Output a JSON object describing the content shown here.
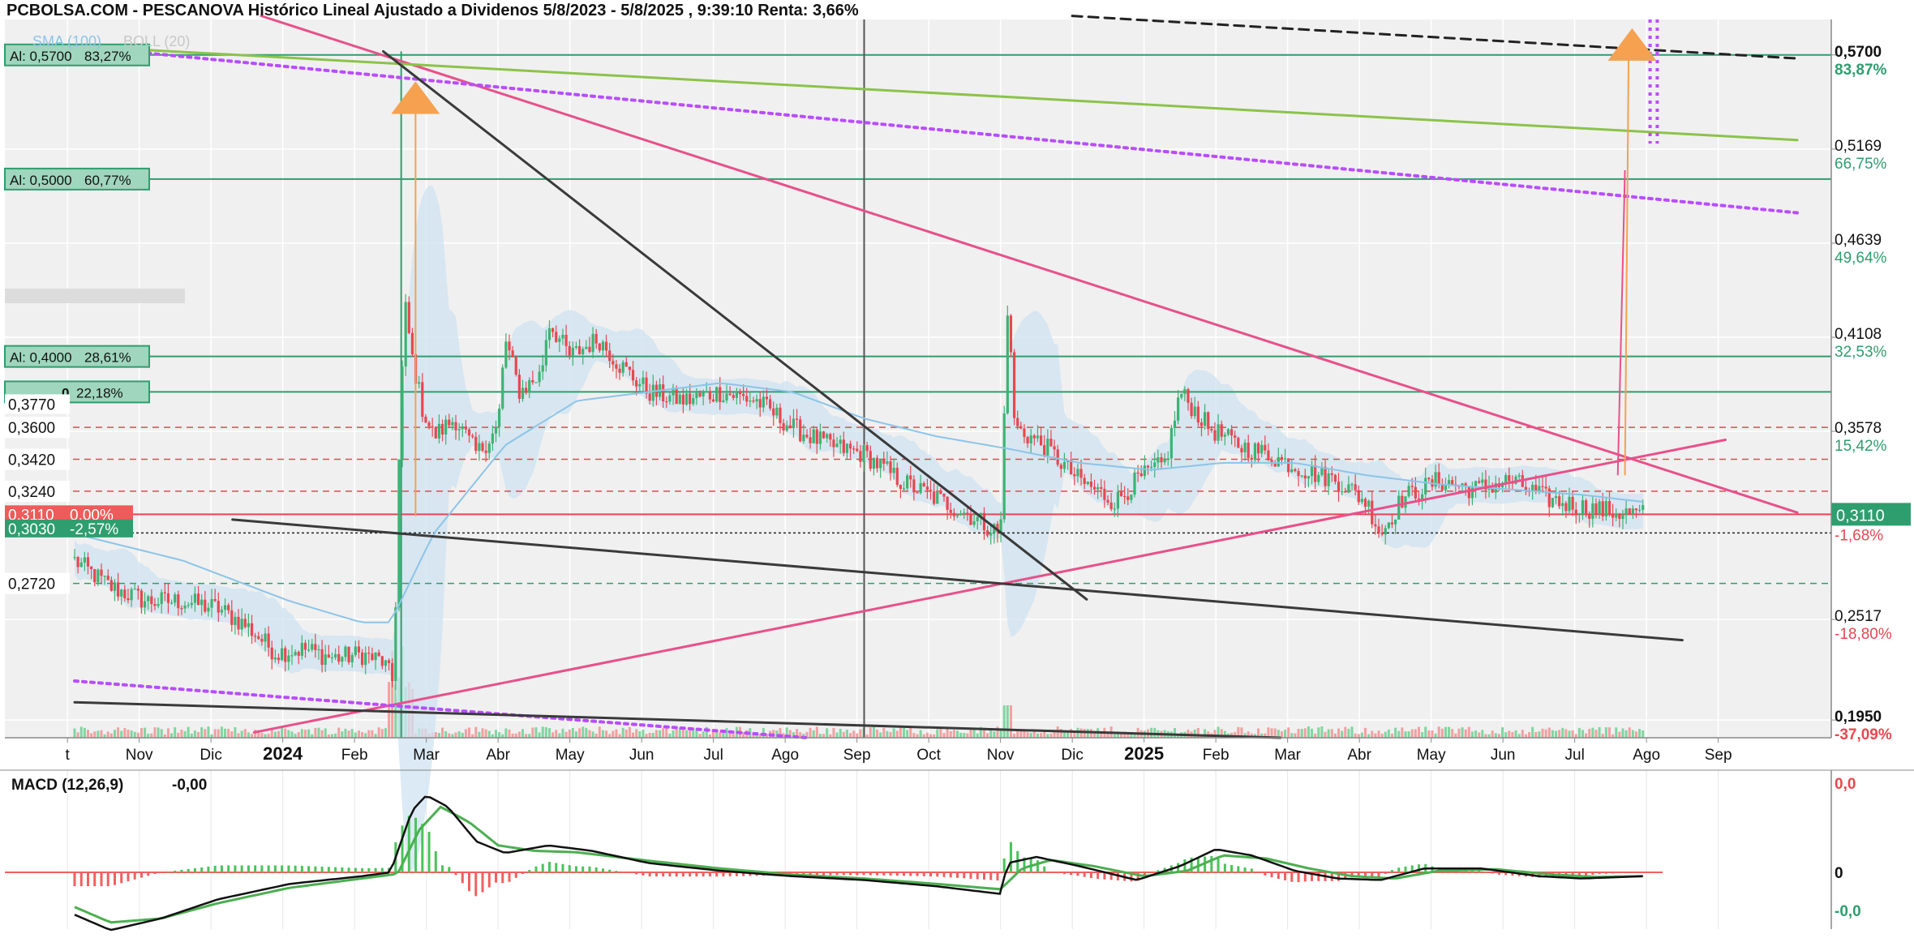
{
  "title": "PCBOLSA.COM - PESCANOVA Histórico Lineal Ajustado a Dividenos 5/8/2023 - 5/8/2025 , 9:39:10 Renta: 3,66%",
  "indicators_legend": {
    "sma": "SMA (100)",
    "boll": "BOLL (20)"
  },
  "colors": {
    "up": "#3cb371",
    "down": "#e8474f",
    "green_line": "#2e9e6e",
    "pink_line": "#e8508a",
    "purple_dotted": "#b84dff",
    "trend_dark": "#3a3a3a",
    "bollinger_fill": "#cfe3f2",
    "sma": "#8cc4e8",
    "tag_green": "#2e9e6e",
    "tag_red": "#f05a5a",
    "arrow": "#f5a150",
    "macd_up": "#49c45a",
    "macd_down": "#f06060"
  },
  "chart_data": [
    {
      "type": "line",
      "title": "PCBOLSA.COM - PESCANOVA Histórico Lineal Ajustado a Dividenos 5/8/2023 - 5/8/2025 , 9:39:10 Renta: 3,66%",
      "xlabel": "",
      "ylabel": "",
      "ylim": [
        0.185,
        0.59
      ],
      "grid": true,
      "x_ticks": [
        {
          "label": "t",
          "month": -0.1,
          "bold": false
        },
        {
          "label": "Nov",
          "month": 0.9,
          "bold": false
        },
        {
          "label": "Dic",
          "month": 1.9,
          "bold": false
        },
        {
          "label": "2024",
          "month": 2.9,
          "bold": true
        },
        {
          "label": "Feb",
          "month": 3.9,
          "bold": false
        },
        {
          "label": "Mar",
          "month": 4.9,
          "bold": false
        },
        {
          "label": "Abr",
          "month": 5.9,
          "bold": false
        },
        {
          "label": "May",
          "month": 6.9,
          "bold": false
        },
        {
          "label": "Jun",
          "month": 7.9,
          "bold": false
        },
        {
          "label": "Jul",
          "month": 8.9,
          "bold": false
        },
        {
          "label": "Ago",
          "month": 9.9,
          "bold": false
        },
        {
          "label": "Sep",
          "month": 10.9,
          "bold": false
        },
        {
          "label": "Oct",
          "month": 11.9,
          "bold": false
        },
        {
          "label": "Nov",
          "month": 12.9,
          "bold": false
        },
        {
          "label": "Dic",
          "month": 13.9,
          "bold": false
        },
        {
          "label": "2025",
          "month": 14.9,
          "bold": true
        },
        {
          "label": "Feb",
          "month": 15.9,
          "bold": false
        },
        {
          "label": "Mar",
          "month": 16.9,
          "bold": false
        },
        {
          "label": "Abr",
          "month": 17.9,
          "bold": false
        },
        {
          "label": "May",
          "month": 18.9,
          "bold": false
        },
        {
          "label": "Jun",
          "month": 19.9,
          "bold": false
        },
        {
          "label": "Jul",
          "month": 20.9,
          "bold": false
        },
        {
          "label": "Ago",
          "month": 21.9,
          "bold": false
        },
        {
          "label": "Sep",
          "month": 22.9,
          "bold": false
        }
      ],
      "right_axis": [
        {
          "price": "0,5700",
          "pct": "83,87%",
          "color": "#2e9e6e",
          "bold": true
        },
        {
          "price": "0,5169",
          "pct": "66,75%",
          "color": "#2e9e6e",
          "bold": false
        },
        {
          "price": "0,4639",
          "pct": "49,64%",
          "color": "#2e9e6e",
          "bold": false
        },
        {
          "price": "0,4108",
          "pct": "32,53%",
          "color": "#2e9e6e",
          "bold": false
        },
        {
          "price": "0,3578",
          "pct": "15,42%",
          "color": "#2e9e6e",
          "bold": false
        },
        {
          "price": "0,2517",
          "pct": "-18,80%",
          "color": "#e8474f",
          "bold": false
        },
        {
          "price": "0,1950",
          "pct": "-37,09%",
          "color": "#e8474f",
          "bold": true
        }
      ],
      "current_price": {
        "label": "0,3110",
        "pct": "-1,68%",
        "value": 0.311
      },
      "alert_levels": [
        {
          "label": "Al: 0,5700",
          "pct": "83,27%",
          "value": 0.57
        },
        {
          "label": "Al: 0,5000",
          "pct": "60,77%",
          "value": 0.5
        },
        {
          "label": "Al: 0,4000",
          "pct": "28,61%",
          "value": 0.4
        },
        {
          "label": "0",
          "pct": "22,18%",
          "value": 0.38
        }
      ],
      "dashed_levels": [
        {
          "label": "0,3600",
          "value": 0.36,
          "color": "#e8474f"
        },
        {
          "label": "0,3420",
          "value": 0.342,
          "color": "#e8474f"
        },
        {
          "label": "0,3240",
          "value": 0.324,
          "color": "#e8474f"
        },
        {
          "label": "0,2720",
          "value": 0.272,
          "color": "#2e9e6e"
        }
      ],
      "level_3770": {
        "label": "0,3770",
        "value": 0.38
      },
      "tags": [
        {
          "label": "0,3110",
          "pct": "0,00%",
          "value": 0.311,
          "color": "#f05a5a"
        },
        {
          "label": "0,3030",
          "pct": "-2,57%",
          "value": 0.303,
          "color": "#2e9e6e"
        }
      ],
      "price_anchors": [
        [
          0,
          0.285
        ],
        [
          0.5,
          0.27
        ],
        [
          1.0,
          0.262
        ],
        [
          1.5,
          0.262
        ],
        [
          2.0,
          0.258
        ],
        [
          2.4,
          0.248
        ],
        [
          2.8,
          0.233
        ],
        [
          3.2,
          0.235
        ],
        [
          3.6,
          0.23
        ],
        [
          4.0,
          0.232
        ],
        [
          4.3,
          0.228
        ],
        [
          4.45,
          0.215
        ],
        [
          4.5,
          0.32
        ],
        [
          4.6,
          0.43
        ],
        [
          4.7,
          0.4
        ],
        [
          4.85,
          0.37
        ],
        [
          5.0,
          0.355
        ],
        [
          5.3,
          0.365
        ],
        [
          5.6,
          0.345
        ],
        [
          5.9,
          0.36
        ],
        [
          6.0,
          0.41
        ],
        [
          6.2,
          0.38
        ],
        [
          6.5,
          0.39
        ],
        [
          6.6,
          0.42
        ],
        [
          6.9,
          0.4
        ],
        [
          7.3,
          0.41
        ],
        [
          7.6,
          0.395
        ],
        [
          8.0,
          0.38
        ],
        [
          8.5,
          0.375
        ],
        [
          9.0,
          0.38
        ],
        [
          9.5,
          0.375
        ],
        [
          10.0,
          0.36
        ],
        [
          10.5,
          0.35
        ],
        [
          11.0,
          0.345
        ],
        [
          11.5,
          0.33
        ],
        [
          12.0,
          0.32
        ],
        [
          12.5,
          0.31
        ],
        [
          12.9,
          0.3
        ],
        [
          13.0,
          0.43
        ],
        [
          13.1,
          0.36
        ],
        [
          13.5,
          0.35
        ],
        [
          14.0,
          0.33
        ],
        [
          14.5,
          0.318
        ],
        [
          14.8,
          0.33
        ],
        [
          15.2,
          0.34
        ],
        [
          15.4,
          0.38
        ],
        [
          15.8,
          0.36
        ],
        [
          16.2,
          0.35
        ],
        [
          16.6,
          0.345
        ],
        [
          17.2,
          0.335
        ],
        [
          17.6,
          0.33
        ],
        [
          18.0,
          0.318
        ],
        [
          18.2,
          0.3
        ],
        [
          18.5,
          0.32
        ],
        [
          19.0,
          0.33
        ],
        [
          19.5,
          0.325
        ],
        [
          20.0,
          0.33
        ],
        [
          20.5,
          0.32
        ],
        [
          21.0,
          0.315
        ],
        [
          21.5,
          0.312
        ],
        [
          21.85,
          0.311
        ]
      ],
      "sma_anchors": [
        [
          0,
          0.3
        ],
        [
          1.5,
          0.285
        ],
        [
          3.0,
          0.262
        ],
        [
          4.0,
          0.25
        ],
        [
          4.4,
          0.25
        ],
        [
          5.0,
          0.3
        ],
        [
          6.0,
          0.35
        ],
        [
          7.0,
          0.375
        ],
        [
          8.0,
          0.38
        ],
        [
          9.0,
          0.385
        ],
        [
          10.0,
          0.38
        ],
        [
          11.0,
          0.365
        ],
        [
          12.0,
          0.355
        ],
        [
          13.0,
          0.348
        ],
        [
          14.0,
          0.34
        ],
        [
          15.0,
          0.336
        ],
        [
          16.0,
          0.34
        ],
        [
          17.0,
          0.34
        ],
        [
          18.0,
          0.333
        ],
        [
          19.0,
          0.328
        ],
        [
          20.0,
          0.325
        ],
        [
          21.0,
          0.322
        ],
        [
          21.85,
          0.318
        ]
      ],
      "trend_lines": [
        {
          "name": "pink-resistance",
          "color": "#e8508a",
          "dash": "",
          "width": 3,
          "from": [
            2.6,
            0.592
          ],
          "to": [
            24.0,
            0.312
          ]
        },
        {
          "name": "pink-support",
          "color": "#e8508a",
          "dash": "",
          "width": 3,
          "from": [
            2.5,
            0.188
          ],
          "to": [
            23.0,
            0.353
          ]
        },
        {
          "name": "green-channel",
          "color": "#8bc34a",
          "dash": "",
          "width": 3,
          "from": [
            0,
            0.575
          ],
          "to": [
            24.0,
            0.522
          ]
        },
        {
          "name": "purple-upper",
          "color": "#b84dff",
          "dash": "4,6",
          "width": 4,
          "from": [
            0,
            0.575
          ],
          "to": [
            24.0,
            0.481
          ]
        },
        {
          "name": "purple-lower",
          "color": "#b84dff",
          "dash": "4,6",
          "width": 4,
          "from": [
            0,
            0.217
          ],
          "to": [
            10.2,
            0.185
          ]
        },
        {
          "name": "dark-falling",
          "color": "#3a3a3a",
          "dash": "",
          "width": 3,
          "from": [
            4.3,
            0.572
          ],
          "to": [
            14.1,
            0.263
          ]
        },
        {
          "name": "dark-channel-mid",
          "color": "#3a3a3a",
          "dash": "",
          "width": 3,
          "from": [
            2.2,
            0.308
          ],
          "to": [
            22.4,
            0.24
          ]
        },
        {
          "name": "dark-channel-low",
          "color": "#3a3a3a",
          "dash": "",
          "width": 3,
          "from": [
            0,
            0.205
          ],
          "to": [
            16.8,
            0.185
          ]
        },
        {
          "name": "dashed-top",
          "color": "#222222",
          "dash": "12,8",
          "width": 3,
          "from": [
            13.9,
            0.592
          ],
          "to": [
            24.0,
            0.568
          ]
        }
      ],
      "vertical_lines": [
        {
          "month": 4.55,
          "color": "#2e9e6e",
          "from": 0.185,
          "to": 0.572
        },
        {
          "month": 11.0,
          "color": "#555555",
          "from": 0.59,
          "to": 0.185
        }
      ],
      "arrows": [
        {
          "month": 4.75,
          "value": 0.545
        },
        {
          "month": 21.7,
          "value": 0.575
        }
      ],
      "notes": "Candlestick daily series (Aug 2023 – Aug 2025) with Bollinger band, SMA(100) and volume bars."
    },
    {
      "type": "line",
      "title": "MACD (12,26,9)",
      "value_label": "-0,00",
      "right_axis": [
        {
          "label": "0,0",
          "color": "#e8474f",
          "pos": "top"
        },
        {
          "label": "0",
          "color": "#111111",
          "pos": "mid"
        },
        {
          "label": "-0,0",
          "color": "#2e9e6e",
          "pos": "bottom"
        }
      ],
      "macd_anchors": [
        [
          0,
          -0.55
        ],
        [
          0.5,
          -0.75
        ],
        [
          1.2,
          -0.6
        ],
        [
          2.0,
          -0.35
        ],
        [
          3.0,
          -0.15
        ],
        [
          4.0,
          -0.05
        ],
        [
          4.4,
          0.0
        ],
        [
          4.7,
          0.8
        ],
        [
          4.9,
          1.0
        ],
        [
          5.2,
          0.85
        ],
        [
          5.6,
          0.4
        ],
        [
          6.0,
          0.25
        ],
        [
          6.6,
          0.35
        ],
        [
          7.2,
          0.28
        ],
        [
          8.0,
          0.12
        ],
        [
          9.0,
          0.02
        ],
        [
          10.0,
          -0.05
        ],
        [
          11.0,
          -0.1
        ],
        [
          12.0,
          -0.18
        ],
        [
          12.9,
          -0.28
        ],
        [
          13.0,
          0.12
        ],
        [
          13.4,
          0.2
        ],
        [
          14.0,
          0.08
        ],
        [
          14.8,
          -0.1
        ],
        [
          15.4,
          0.08
        ],
        [
          15.9,
          0.3
        ],
        [
          16.4,
          0.22
        ],
        [
          17.0,
          0.02
        ],
        [
          17.6,
          -0.08
        ],
        [
          18.2,
          -0.1
        ],
        [
          18.8,
          0.05
        ],
        [
          19.6,
          0.05
        ],
        [
          20.4,
          -0.05
        ],
        [
          21.0,
          -0.08
        ],
        [
          21.85,
          -0.05
        ]
      ],
      "signal_anchors": [
        [
          0,
          -0.45
        ],
        [
          0.5,
          -0.65
        ],
        [
          1.2,
          -0.6
        ],
        [
          2.0,
          -0.4
        ],
        [
          3.0,
          -0.2
        ],
        [
          4.0,
          -0.08
        ],
        [
          4.5,
          -0.02
        ],
        [
          4.8,
          0.55
        ],
        [
          5.1,
          0.85
        ],
        [
          5.5,
          0.65
        ],
        [
          5.9,
          0.35
        ],
        [
          6.4,
          0.28
        ],
        [
          7.0,
          0.26
        ],
        [
          8.0,
          0.15
        ],
        [
          9.0,
          0.05
        ],
        [
          10.0,
          -0.03
        ],
        [
          11.0,
          -0.08
        ],
        [
          12.0,
          -0.15
        ],
        [
          12.9,
          -0.22
        ],
        [
          13.2,
          0.05
        ],
        [
          13.6,
          0.16
        ],
        [
          14.2,
          0.08
        ],
        [
          14.9,
          -0.05
        ],
        [
          15.5,
          0.02
        ],
        [
          16.0,
          0.22
        ],
        [
          16.6,
          0.18
        ],
        [
          17.2,
          0.05
        ],
        [
          17.8,
          -0.05
        ],
        [
          18.4,
          -0.08
        ],
        [
          19.0,
          0.02
        ],
        [
          19.8,
          0.04
        ],
        [
          20.6,
          -0.03
        ],
        [
          21.2,
          -0.06
        ],
        [
          21.85,
          -0.05
        ]
      ]
    }
  ]
}
